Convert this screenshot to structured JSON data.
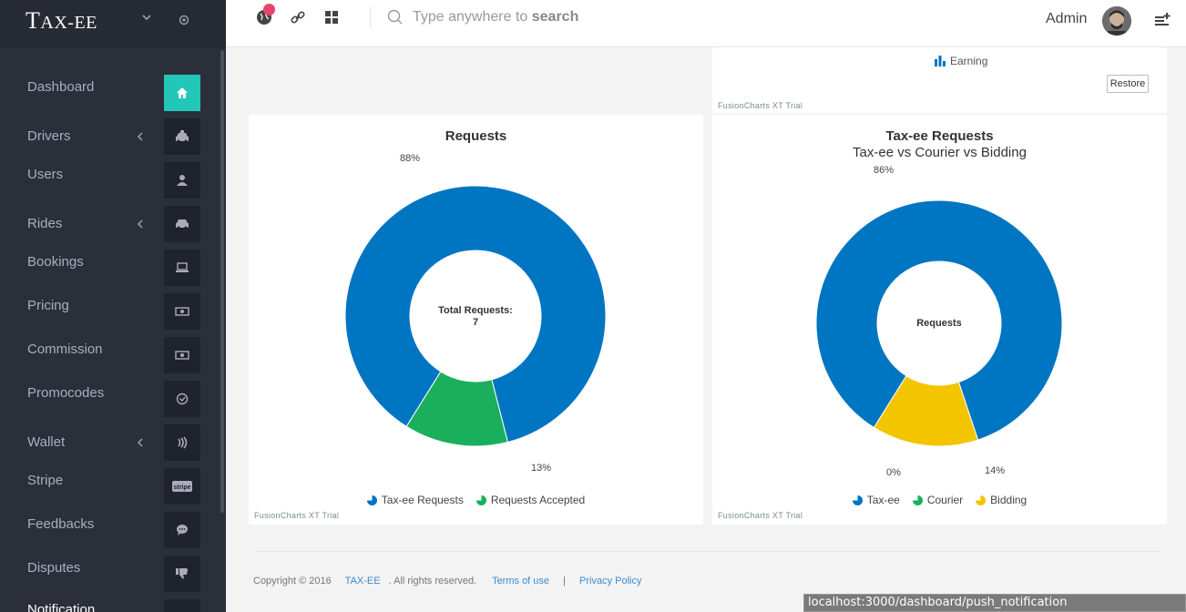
{
  "app": {
    "logo_big": "T",
    "logo_rest": "AX-EE"
  },
  "sidebar": {
    "items": [
      {
        "label": "Dashboard",
        "icon": "home-icon",
        "has_submenu": false,
        "active": true
      },
      {
        "label": "Drivers",
        "icon": "taxi-icon",
        "has_submenu": true
      },
      {
        "label": "Users",
        "icon": "user-icon",
        "has_submenu": false
      },
      {
        "label": "Rides",
        "icon": "car-icon",
        "has_submenu": true
      },
      {
        "label": "Bookings",
        "icon": "laptop-icon",
        "has_submenu": false
      },
      {
        "label": "Pricing",
        "icon": "money-icon",
        "has_submenu": false
      },
      {
        "label": "Commission",
        "icon": "money-icon",
        "has_submenu": false
      },
      {
        "label": "Promocodes",
        "icon": "clock-icon",
        "has_submenu": false
      },
      {
        "label": "Wallet",
        "icon": "contactless-icon",
        "has_submenu": true
      },
      {
        "label": "Stripe",
        "icon": "stripe-icon",
        "has_submenu": false
      },
      {
        "label": "Feedbacks",
        "icon": "chat-icon",
        "has_submenu": false
      },
      {
        "label": "Disputes",
        "icon": "thumbs-down-icon",
        "has_submenu": false
      },
      {
        "label": "Notification",
        "icon": "bell-icon",
        "has_submenu": false
      }
    ],
    "stripe_text": "stripe"
  },
  "header": {
    "search_placeholder_main": "Type anywhere to ",
    "search_placeholder_bold": "search",
    "admin_name": "Admin"
  },
  "top_panel": {
    "legend_label": "Earning",
    "restore_label": "Restore",
    "trial_label": "FusionCharts XT Trial"
  },
  "chart_data": [
    {
      "type": "pie",
      "title": "Requests",
      "subtitle": "",
      "center_label_line1": "Total Requests:",
      "center_label_line2": "7",
      "series": [
        {
          "name": "Tax-ee Requests",
          "value": 88,
          "label": "88%",
          "color": "#0075c2"
        },
        {
          "name": "Requests Accepted",
          "value": 13,
          "label": "13%",
          "color": "#1aaf5d"
        }
      ],
      "trial_label": "FusionCharts XT Trial"
    },
    {
      "type": "pie",
      "title": "Tax-ee Requests",
      "subtitle": "Tax-ee vs Courier vs Bidding",
      "center_label_line1": "Requests",
      "center_label_line2": "",
      "series": [
        {
          "name": "Tax-ee",
          "value": 86,
          "label": "86%",
          "color": "#0075c2"
        },
        {
          "name": "Courier",
          "value": 0,
          "label": "0%",
          "color": "#1aaf5d"
        },
        {
          "name": "Bidding",
          "value": 14,
          "label": "14%",
          "color": "#f2c500"
        }
      ],
      "trial_label": "FusionCharts XT Trial"
    }
  ],
  "footer": {
    "copyright": "Copyright © 2016",
    "brand": "TAX-EE",
    "rights": ". All rights reserved.",
    "terms": "Terms of use",
    "separator": "|",
    "privacy": "Privacy Policy"
  },
  "status_bar": {
    "url": "localhost:3000/dashboard/push_notification"
  }
}
